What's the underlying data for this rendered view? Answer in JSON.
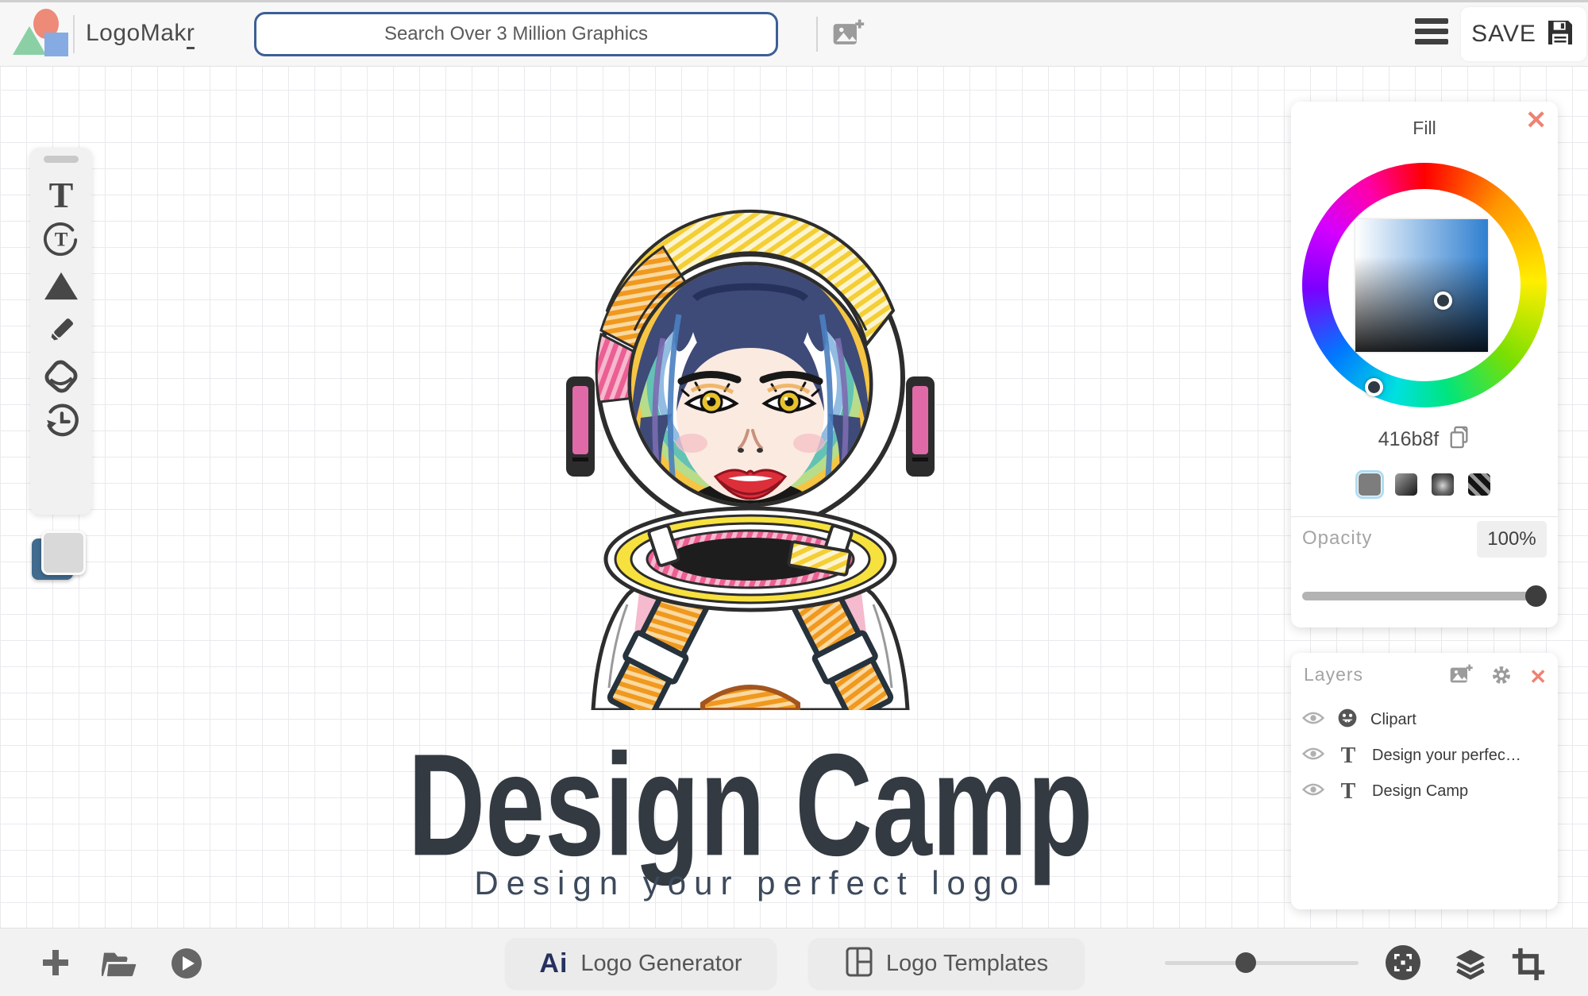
{
  "header": {
    "brand_main": "LogoMak",
    "brand_accent": "r",
    "search_placeholder": "Search Over 3 Million Graphics",
    "save_label": "SAVE"
  },
  "fill_panel": {
    "title": "Fill",
    "close_glyph": "✕",
    "hex": "416b8f",
    "selected_hex": "#416b8f",
    "opacity_label": "Opacity",
    "opacity_value": "100%"
  },
  "layers_panel": {
    "title": "Layers",
    "close_glyph": "✕",
    "rows": [
      {
        "label": "Clipart",
        "icon": "clipart-smiley"
      },
      {
        "label": "Design your perfec…",
        "icon": "text"
      },
      {
        "label": "Design Camp",
        "icon": "text"
      }
    ]
  },
  "canvas": {
    "logo_title": "Design Camp",
    "logo_subtitle": "Design your perfect logo"
  },
  "toolbar": {
    "text_tool_glyph": "T"
  },
  "footer": {
    "ai_glyph": "Ai",
    "generator_label": "Logo Generator",
    "templates_label": "Logo Templates"
  },
  "colors": {
    "accent_close": "#ee8272",
    "fill_blue": "#416b8f"
  }
}
